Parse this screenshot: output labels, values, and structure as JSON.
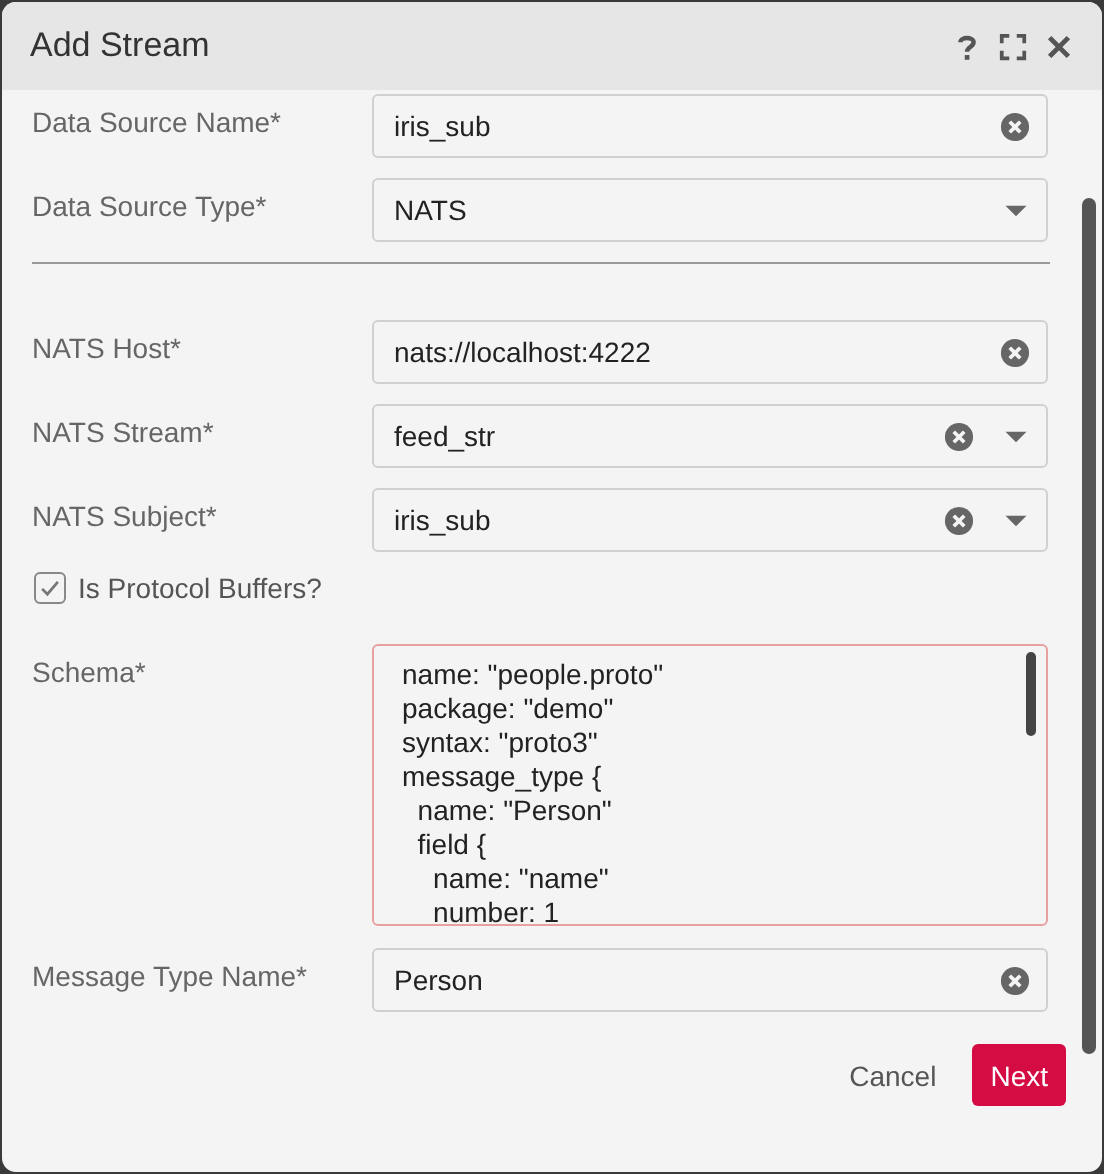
{
  "window": {
    "title": "Add Stream"
  },
  "fields_top": [
    {
      "label": "Data Source Name*",
      "kind": "text",
      "value": "iris_sub"
    },
    {
      "label": "Data Source Type*",
      "kind": "select",
      "value": "NATS"
    }
  ],
  "fields": [
    {
      "label": "NATS Host*",
      "kind": "text",
      "value": "nats://localhost:4222"
    },
    {
      "label": "NATS Stream*",
      "kind": "combo",
      "value": "feed_str"
    },
    {
      "label": "NATS Subject*",
      "kind": "combo",
      "value": "iris_sub"
    }
  ],
  "protobuf": {
    "label": "Is Protocol Buffers?",
    "checked": true
  },
  "schema": {
    "label": "Schema*",
    "invalid": true,
    "lines": [
      "name: \"people.proto\"",
      "package: \"demo\"",
      "syntax: \"proto3\"",
      "message_type {",
      "  name: \"Person\"",
      "  field {",
      "    name: \"name\"",
      "    number: 1"
    ]
  },
  "fields_bottom": [
    {
      "label": "Message Type Name*",
      "kind": "text",
      "value": "Person"
    }
  ],
  "buttons": {
    "cancel": "Cancel",
    "next": "Next"
  }
}
